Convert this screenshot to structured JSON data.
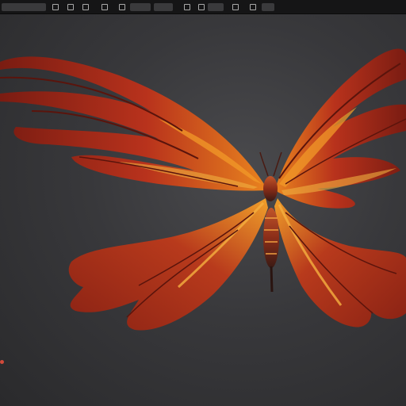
{
  "toolbar": {
    "app_label": "",
    "search_label": "",
    "menu_1": "",
    "menu_2": "",
    "menu_3": "",
    "menu_4": ""
  },
  "viewport": {
    "info_line": "",
    "log": [
      "",
      "",
      "",
      "",
      "",
      ""
    ]
  },
  "colors": {
    "background": "#2e2e30",
    "toolbar": "#151516",
    "wing_dark": "#7a1c12",
    "wing_mid": "#b8321c",
    "wing_light": "#e8821e",
    "log_badge": "#d24a3a"
  }
}
